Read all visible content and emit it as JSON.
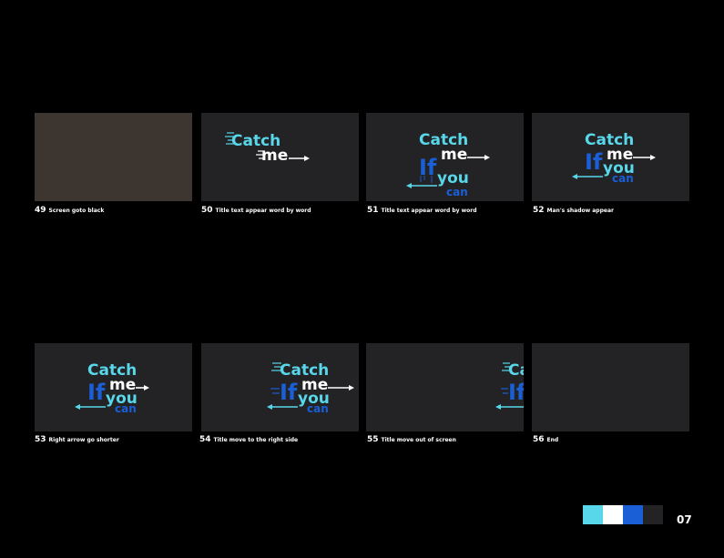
{
  "storyboard": {
    "frames": [
      {
        "num": "49",
        "caption": "Screen goto black"
      },
      {
        "num": "50",
        "caption": "Title text appear word by word"
      },
      {
        "num": "51",
        "caption": "Title text appear word by word"
      },
      {
        "num": "52",
        "caption": "Man's shadow appear"
      },
      {
        "num": "53",
        "caption": "Right arrow go shorter"
      },
      {
        "num": "54",
        "caption": "Title move to the right side"
      },
      {
        "num": "55",
        "caption": "Title move out of screen"
      },
      {
        "num": "56",
        "caption": "End"
      }
    ],
    "title_words": {
      "w1": "Catch",
      "w2": "me",
      "w3": "If",
      "w4": "you",
      "w5": "can"
    }
  },
  "palette": {
    "colors": [
      "#58d7eb",
      "#ffffff",
      "#1a5fd6",
      "#232325"
    ]
  },
  "page_number": "07"
}
